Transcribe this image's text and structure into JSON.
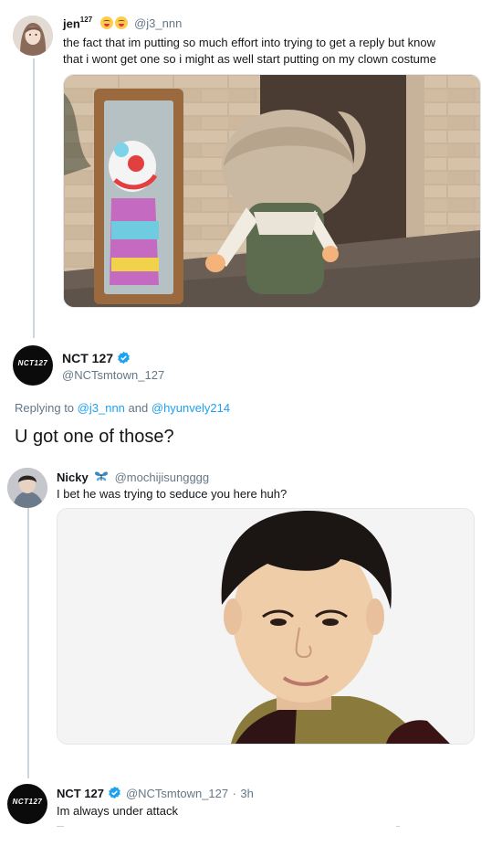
{
  "tweet1": {
    "name": "jen",
    "sup": "127",
    "handle": "@j3_nnn",
    "text_line1": "the fact that im putting so much effort into trying to get a reply but know",
    "text_line2": "that i wont get one so i might as well start putting on my clown costume",
    "emoji_icons": [
      "tongue-face-icon",
      "tongue-face-icon"
    ]
  },
  "tweet2": {
    "name": "NCT 127",
    "handle": "@NCTsmtown_127",
    "replying_prefix": "Replying to",
    "reply_user1": "@j3_nnn",
    "reply_and": "and",
    "reply_user2": "@hyunvely214",
    "text": "U got one of those?",
    "avatar_text": "NCT127"
  },
  "tweet3": {
    "name": "Nicky",
    "handle": "@mochijisungggg",
    "text": "I bet he was trying to seduce you here huh?"
  },
  "tweet4": {
    "name": "NCT 127",
    "handle": "@NCTsmtown_127",
    "separator": "·",
    "time": "3h",
    "text": "Im always under attack",
    "avatar_text": "NCT127"
  },
  "colors": {
    "link": "#1da1f2",
    "verified": "#1da1f2",
    "muted": "#657786"
  }
}
